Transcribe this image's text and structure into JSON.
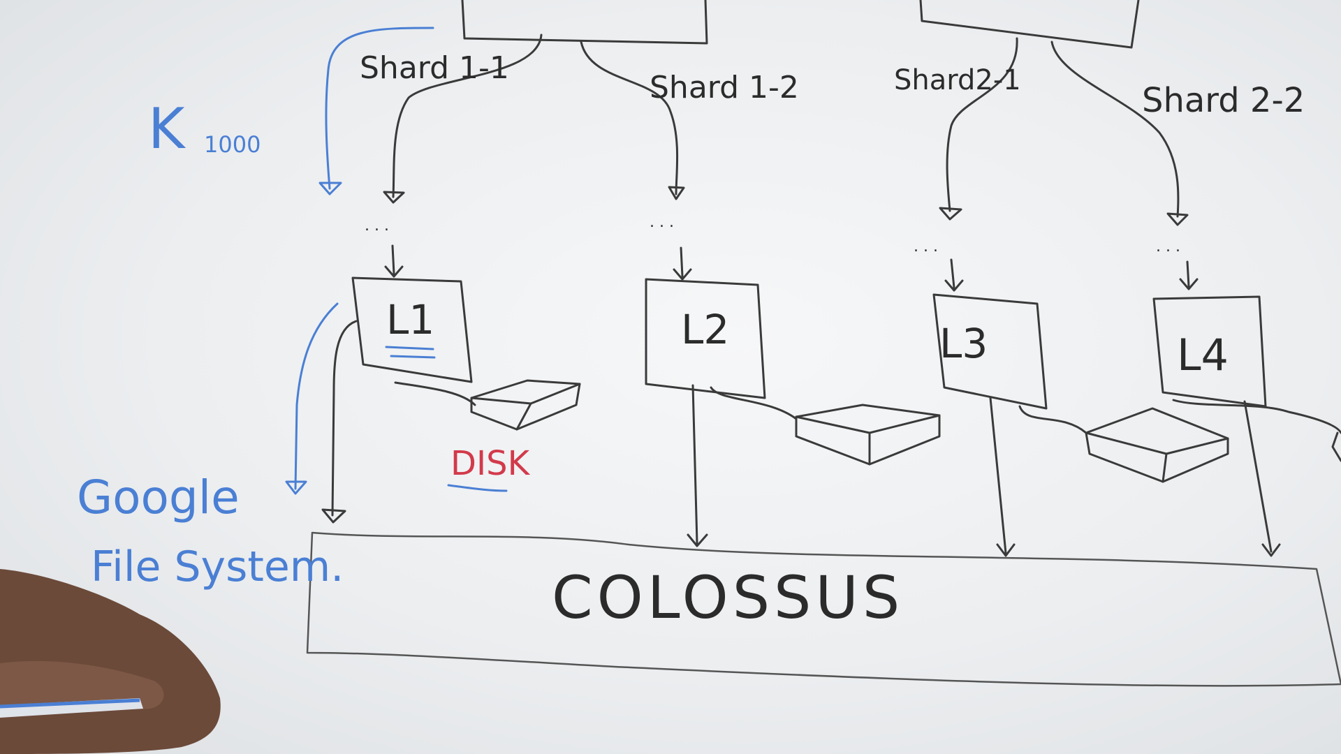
{
  "whiteboard": {
    "shards": {
      "s11": "Shard 1-1",
      "s12": "Shard 1-2",
      "s21": "Shard2-1",
      "s22": "Shard 2-2"
    },
    "k_label": "K",
    "k_subscript": "1000",
    "leaf_labels": {
      "l1": "L1",
      "l2": "L2",
      "l3": "L3",
      "l4": "L4"
    },
    "disk_label": "DISK",
    "gfs_line1": "Google",
    "gfs_line2": "File System.",
    "storage_label": "COLOSSUS",
    "dots": ". . .",
    "colors": {
      "ink": "#3a3a3a",
      "blue_marker": "#4a7fd4",
      "red_marker": "#d23a4b"
    }
  }
}
